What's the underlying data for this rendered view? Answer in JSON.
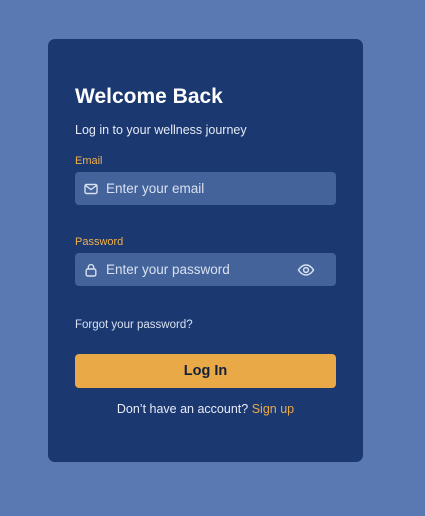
{
  "page": {
    "background_color": "#5a78b2"
  },
  "login_card": {
    "background_color": "#1b3871",
    "title": "Welcome Back",
    "subtitle": "Log in to your wellness journey",
    "email": {
      "label": "Email",
      "placeholder": "Enter your email",
      "value": "",
      "icon": "mail-icon"
    },
    "password": {
      "label": "Password",
      "placeholder": "Enter your password",
      "value": "",
      "icon": "lock-icon",
      "toggle_icon": "eye-icon"
    },
    "forgot_password_text": "Forgot your password?",
    "login_button_label": "Log In",
    "signup_prompt": "Don’t have an account?",
    "signup_link_text": "Sign up",
    "colors": {
      "accent": "#eaa947",
      "label": "#f0b04a",
      "input_background": "#43639a"
    }
  }
}
